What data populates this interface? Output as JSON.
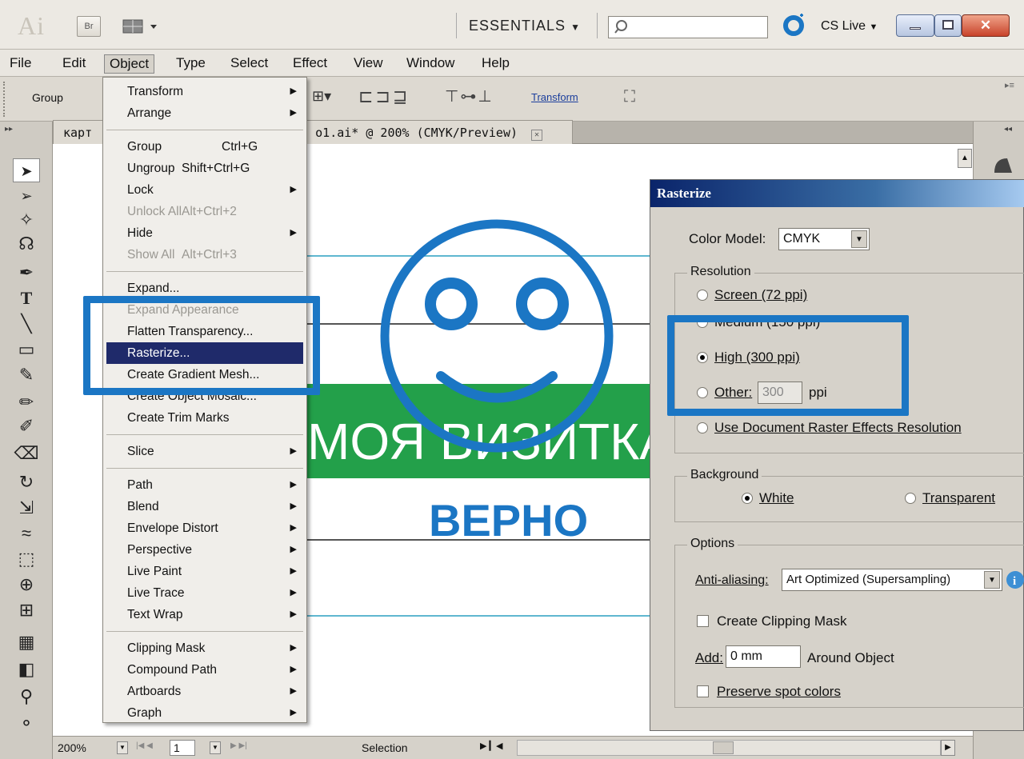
{
  "app": {
    "logo": "Ai",
    "bridge": "Br",
    "workspace": "ESSENTIALS",
    "cs_live": "CS Live"
  },
  "menubar": [
    "File",
    "Edit",
    "Object",
    "Type",
    "Select",
    "Effect",
    "View",
    "Window",
    "Help"
  ],
  "control_bar": {
    "label": "Group",
    "transform_link": "Transform"
  },
  "doc_tab": {
    "prefix": "карт",
    "title": "o1.ai* @ 200% (CMYK/Preview)"
  },
  "object_menu": {
    "items": [
      {
        "label": "Transform",
        "shortcut": "",
        "submenu": true,
        "state": "normal"
      },
      {
        "label": "Arrange",
        "shortcut": "",
        "submenu": true,
        "state": "normal"
      },
      {
        "label": "Group",
        "shortcut": "Ctrl+G",
        "submenu": false,
        "state": "normal"
      },
      {
        "label": "Ungroup",
        "shortcut": "Shift+Ctrl+G",
        "submenu": false,
        "state": "normal"
      },
      {
        "label": "Lock",
        "shortcut": "",
        "submenu": true,
        "state": "normal"
      },
      {
        "label": "Unlock All",
        "shortcut": "Alt+Ctrl+2",
        "submenu": false,
        "state": "disabled"
      },
      {
        "label": "Hide",
        "shortcut": "",
        "submenu": true,
        "state": "normal"
      },
      {
        "label": "Show All",
        "shortcut": "Alt+Ctrl+3",
        "submenu": false,
        "state": "disabled"
      },
      {
        "label": "Expand...",
        "shortcut": "",
        "submenu": false,
        "state": "normal"
      },
      {
        "label": "Expand Appearance",
        "shortcut": "",
        "submenu": false,
        "state": "disabled"
      },
      {
        "label": "Flatten Transparency...",
        "shortcut": "",
        "submenu": false,
        "state": "normal"
      },
      {
        "label": "Rasterize...",
        "shortcut": "",
        "submenu": false,
        "state": "selected"
      },
      {
        "label": "Create Gradient Mesh...",
        "shortcut": "",
        "submenu": false,
        "state": "normal"
      },
      {
        "label": "Create Object Mosaic...",
        "shortcut": "",
        "submenu": false,
        "state": "normal"
      },
      {
        "label": "Create Trim Marks",
        "shortcut": "",
        "submenu": false,
        "state": "normal"
      },
      {
        "label": "Slice",
        "shortcut": "",
        "submenu": true,
        "state": "normal"
      },
      {
        "label": "Path",
        "shortcut": "",
        "submenu": true,
        "state": "normal"
      },
      {
        "label": "Blend",
        "shortcut": "",
        "submenu": true,
        "state": "normal"
      },
      {
        "label": "Envelope Distort",
        "shortcut": "",
        "submenu": true,
        "state": "normal"
      },
      {
        "label": "Perspective",
        "shortcut": "",
        "submenu": true,
        "state": "normal"
      },
      {
        "label": "Live Paint",
        "shortcut": "",
        "submenu": true,
        "state": "normal"
      },
      {
        "label": "Live Trace",
        "shortcut": "",
        "submenu": true,
        "state": "normal"
      },
      {
        "label": "Text Wrap",
        "shortcut": "",
        "submenu": true,
        "state": "normal"
      },
      {
        "label": "Clipping Mask",
        "shortcut": "",
        "submenu": true,
        "state": "normal"
      },
      {
        "label": "Compound Path",
        "shortcut": "",
        "submenu": true,
        "state": "normal"
      },
      {
        "label": "Artboards",
        "shortcut": "",
        "submenu": true,
        "state": "normal"
      },
      {
        "label": "Graph",
        "shortcut": "",
        "submenu": true,
        "state": "normal"
      }
    ]
  },
  "artwork": {
    "banner_text": "МОЯ ВИЗИТКА",
    "caption": "ВЕРНО",
    "accent": "#1b76c4",
    "banner_color": "#23a04a"
  },
  "dialog": {
    "title": "Rasterize",
    "color_model_label": "Color Model:",
    "color_model_value": "CMYK",
    "resolution_label": "Resolution",
    "res_screen": "Screen (72 ppi)",
    "res_medium": "Medium (150 ppi)",
    "res_high": "High (300 ppi)",
    "res_other": "Other:",
    "res_other_value": "300",
    "res_other_unit": "ppi",
    "res_document": "Use Document Raster Effects Resolution",
    "background_label": "Background",
    "bg_white": "White",
    "bg_transparent": "Transparent",
    "options_label": "Options",
    "antialias_label": "Anti-aliasing:",
    "antialias_value": "Art Optimized (Supersampling)",
    "clipping_mask": "Create Clipping Mask",
    "add_label": "Add:",
    "add_value": "0 mm",
    "around_object": "Around Object",
    "preserve_spot": "Preserve spot colors"
  },
  "statusbar": {
    "zoom": "200%",
    "page": "1",
    "tool": "Selection"
  }
}
